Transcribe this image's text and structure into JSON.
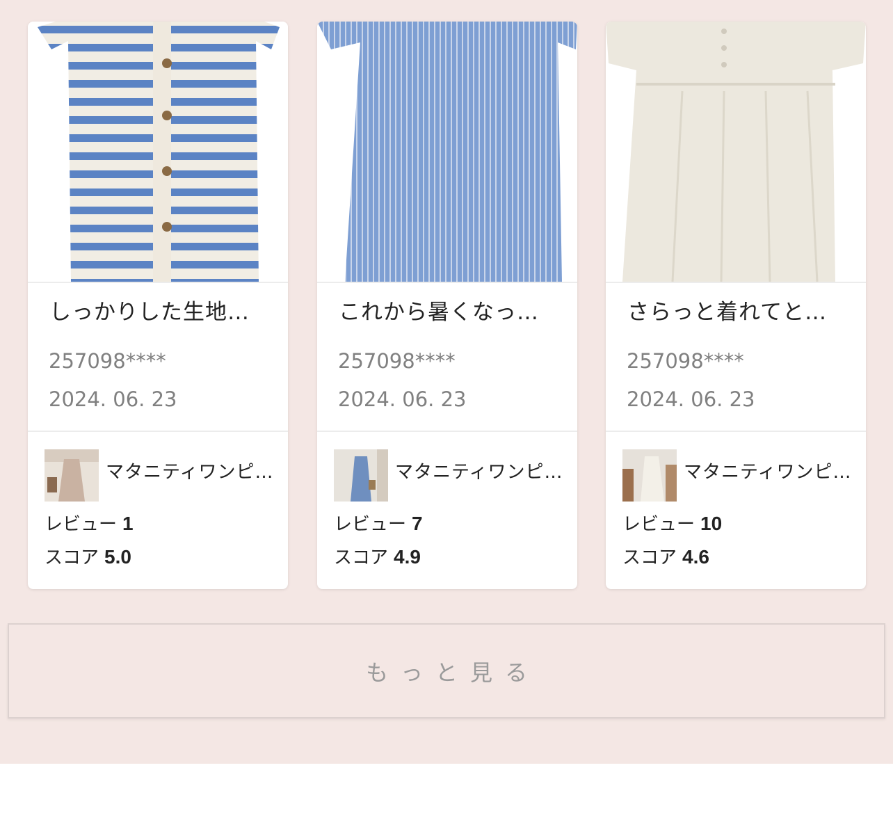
{
  "reviews": [
    {
      "text": "しっかりした生地…",
      "user_id": "257098****",
      "date": "2024. 06. 23",
      "product_name": "マタニティワンピ…",
      "review_label": "レビュー",
      "review_count": "1",
      "score_label": "スコア",
      "score": "5.0",
      "photo_icon": "striped-dress-photo",
      "thumb_icon": "product-thumbnail"
    },
    {
      "text": "これから暑くなっ…",
      "user_id": "257098****",
      "date": "2024. 06. 23",
      "product_name": "マタニティワンピ…",
      "review_label": "レビュー",
      "review_count": "7",
      "score_label": "スコア",
      "score": "4.9",
      "photo_icon": "blue-dress-photo",
      "thumb_icon": "product-thumbnail"
    },
    {
      "text": "さらっと着れてと…",
      "user_id": "257098****",
      "date": "2024. 06. 23",
      "product_name": "マタニティワンピ…",
      "review_label": "レビュー",
      "review_count": "10",
      "score_label": "スコア",
      "score": "4.6",
      "photo_icon": "white-dress-photo",
      "thumb_icon": "product-thumbnail"
    }
  ],
  "more_button": {
    "label": "もっと見る"
  },
  "colors": {
    "panel_background": "#f4e7e4",
    "card_background": "#ffffff",
    "text_primary": "#222222",
    "text_muted": "#808080",
    "stripe_blue": "#5b83c4",
    "dress_blue": "#7e9fd3",
    "dress_white": "#ece8de"
  }
}
